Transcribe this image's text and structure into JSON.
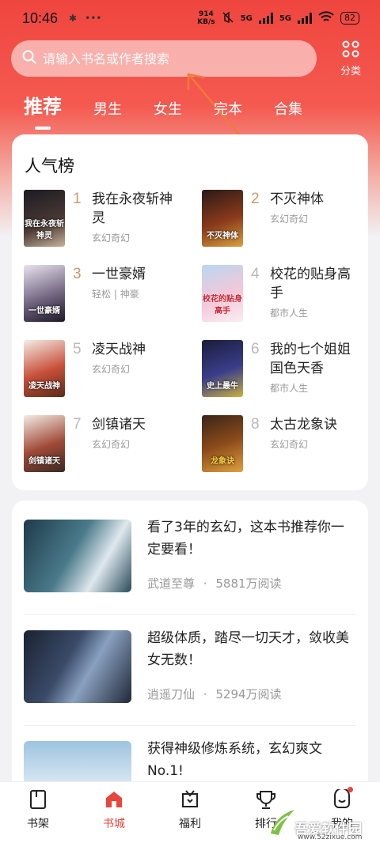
{
  "status_bar": {
    "time": "10:46",
    "net_speed_value": "914",
    "net_speed_unit": "KB/s",
    "signal1": "5G",
    "signal2": "5G",
    "battery": "82"
  },
  "search": {
    "placeholder": "请输入书名或作者搜索"
  },
  "category": {
    "label": "分类"
  },
  "tabs": [
    {
      "label": "推荐",
      "active": true
    },
    {
      "label": "男生"
    },
    {
      "label": "女生"
    },
    {
      "label": "完本"
    },
    {
      "label": "合集"
    }
  ],
  "ranking": {
    "title": "人气榜",
    "items": [
      {
        "rank": "1",
        "name": "我在永夜斩神灵",
        "tag": "玄幻奇幻",
        "cover_text": "我在永夜斩神灵"
      },
      {
        "rank": "2",
        "name": "不灭神体",
        "tag": "玄幻奇幻",
        "cover_text": "不灭神体"
      },
      {
        "rank": "3",
        "name": "一世豪婿",
        "tag": "轻松 | 神豪",
        "cover_text": "一世豪婿"
      },
      {
        "rank": "4",
        "name": "校花的贴身高手",
        "tag": "都市人生",
        "cover_text": "校花的贴身高手"
      },
      {
        "rank": "5",
        "name": "凌天战神",
        "tag": "玄幻奇幻",
        "cover_text": "凌天战神"
      },
      {
        "rank": "6",
        "name": "我的七个姐姐国色天香",
        "tag": "都市人生",
        "cover_text": "史上最牛"
      },
      {
        "rank": "7",
        "name": "剑镇诸天",
        "tag": "玄幻奇幻",
        "cover_text": "剑镇诸天"
      },
      {
        "rank": "8",
        "name": "太古龙象诀",
        "tag": "玄幻奇幻",
        "cover_text": "龙象诀"
      }
    ]
  },
  "feed": [
    {
      "title": "看了3年的玄幻，这本书推荐你一定要看！",
      "book": "武道至尊",
      "reads": "5881万阅读",
      "sep": "·"
    },
    {
      "title": "超级体质，踏尽一切天才，敛收美女无数！",
      "book": "逍遥刀仙",
      "reads": "5294万阅读",
      "sep": "·"
    },
    {
      "title": "获得神级修炼系统，玄幻爽文No.1!",
      "book": "",
      "reads": "",
      "sep": ""
    }
  ],
  "bottom_nav": [
    {
      "label": "书架"
    },
    {
      "label": "书城",
      "active": true
    },
    {
      "label": "福利"
    },
    {
      "label": "排行"
    },
    {
      "label": "我的"
    }
  ],
  "watermark": {
    "text": "吾爱软件园",
    "url": "www.52zixue.com"
  },
  "colors": {
    "accent": "#e8453c",
    "header": "#f0453f",
    "rank_top": "#c99a6a"
  }
}
